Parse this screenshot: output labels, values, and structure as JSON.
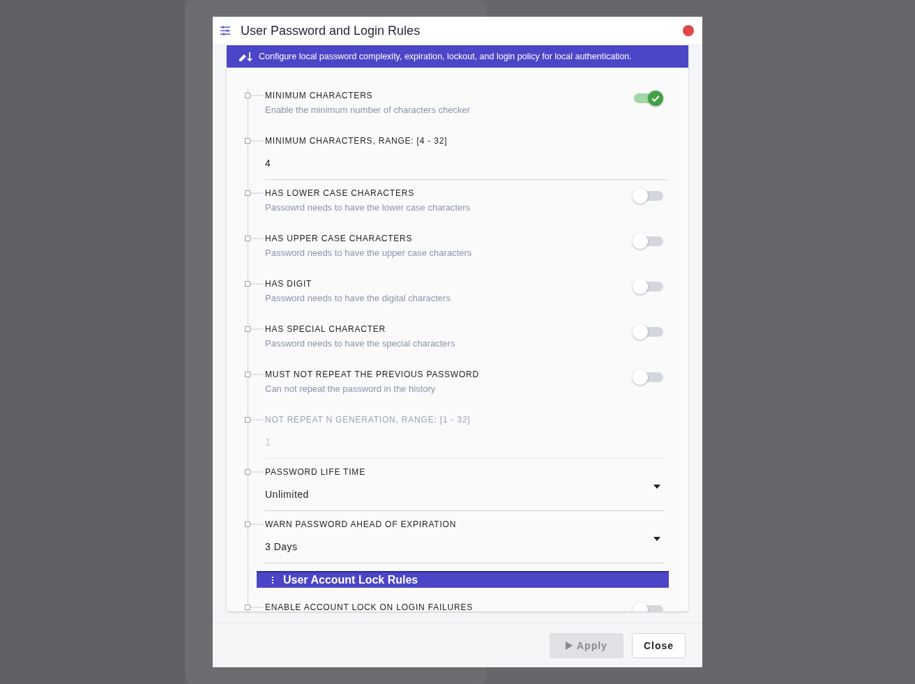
{
  "dialog": {
    "title": "User Password and Login Rules",
    "banner": "Configure local password complexity, expiration, lockout, and login policy for local authentication.",
    "rules": [
      {
        "kind": "toggle",
        "label": "MINIMUM CHARACTERS",
        "description": "Enable the minimum number of characters checker",
        "on": true
      },
      {
        "kind": "number",
        "label": "MINIMUM CHARACTERS, RANGE: [4 - 32]",
        "value": "4",
        "disabled": false
      },
      {
        "kind": "toggle",
        "label": "HAS LOWER CASE CHARACTERS",
        "description": "Passowrd needs to have the lower case characters",
        "on": false
      },
      {
        "kind": "toggle",
        "label": "HAS UPPER CASE CHARACTERS",
        "description": "Password needs to have the upper case characters",
        "on": false
      },
      {
        "kind": "toggle",
        "label": "HAS DIGIT",
        "description": "Password needs to have the digital characters",
        "on": false
      },
      {
        "kind": "toggle",
        "label": "HAS SPECIAL CHARACTER",
        "description": "Password needs to have the special characters",
        "on": false
      },
      {
        "kind": "toggle",
        "label": "MUST NOT REPEAT THE PREVIOUS PASSWORD",
        "description": "Can not repeat the password in the history",
        "on": false
      },
      {
        "kind": "number",
        "label": "NOT REPEAT N GENERATION, RANGE: [1 - 32]",
        "value": "1",
        "disabled": true
      },
      {
        "kind": "select",
        "label": "PASSWORD LIFE TIME",
        "value": "Unlimited"
      },
      {
        "kind": "select",
        "label": "WARN PASSWORD AHEAD OF EXPIRATION",
        "value": "3 Days"
      },
      {
        "kind": "section",
        "label": "User Account Lock Rules"
      },
      {
        "kind": "toggle",
        "label": "ENABLE ACCOUNT LOCK ON LOGIN FAILURES",
        "on": false
      }
    ],
    "buttons": [
      {
        "label": "Apply",
        "disabled": true
      },
      {
        "label": "Close",
        "disabled": false
      }
    ]
  }
}
